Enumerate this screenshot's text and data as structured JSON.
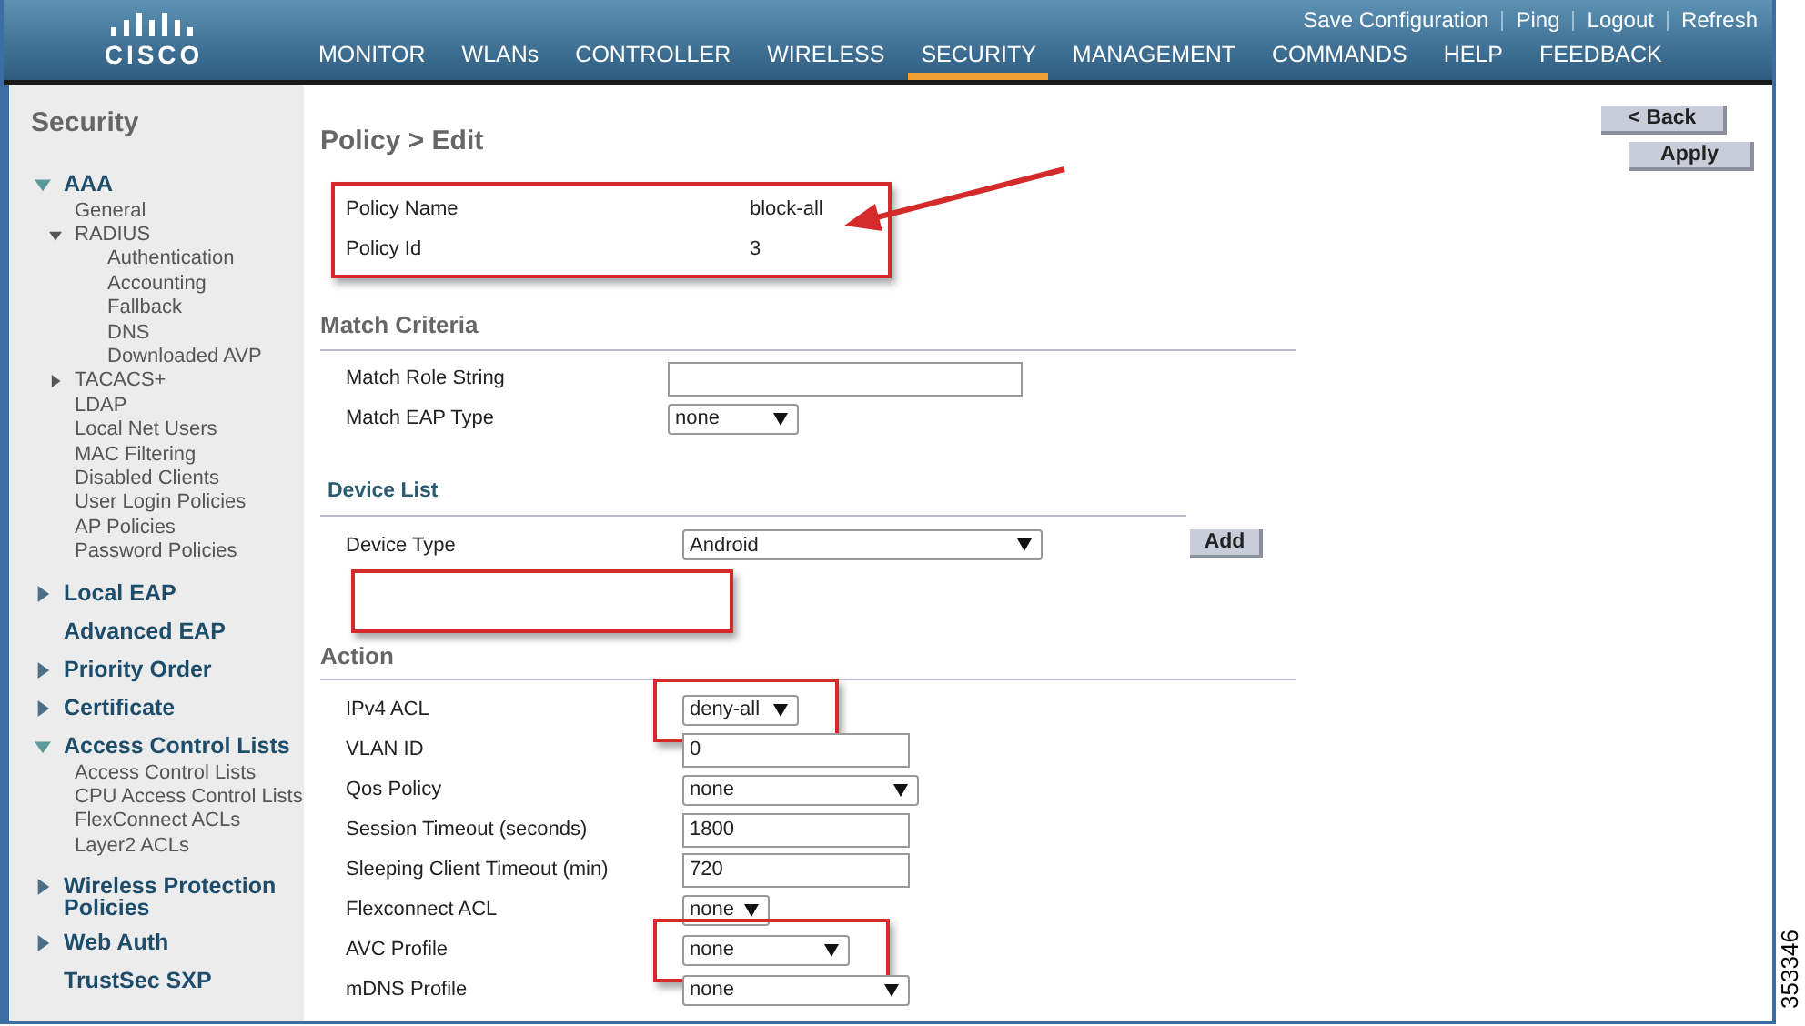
{
  "header": {
    "logo": "CISCO",
    "top_links": [
      "Save Configuration",
      "Ping",
      "Logout",
      "Refresh"
    ],
    "tabs": [
      {
        "label": "MONITOR",
        "selected": false
      },
      {
        "label": "WLANs",
        "selected": false
      },
      {
        "label": "CONTROLLER",
        "selected": false
      },
      {
        "label": "WIRELESS",
        "selected": false
      },
      {
        "label": "SECURITY",
        "selected": true
      },
      {
        "label": "MANAGEMENT",
        "selected": false
      },
      {
        "label": "COMMANDS",
        "selected": false
      },
      {
        "label": "HELP",
        "selected": false
      },
      {
        "label": "FEEDBACK",
        "selected": false
      }
    ]
  },
  "sidebar": {
    "title": "Security",
    "items": [
      {
        "label": "AAA",
        "expanded": true,
        "children": [
          {
            "label": "General"
          },
          {
            "label": "RADIUS",
            "expanded": true,
            "children": [
              {
                "label": "Authentication"
              },
              {
                "label": "Accounting"
              },
              {
                "label": "Fallback"
              },
              {
                "label": "DNS"
              },
              {
                "label": "Downloaded AVP"
              }
            ]
          },
          {
            "label": "TACACS+",
            "expanded": false
          },
          {
            "label": "LDAP"
          },
          {
            "label": "Local Net Users"
          },
          {
            "label": "MAC Filtering"
          },
          {
            "label": "Disabled Clients"
          },
          {
            "label": "User Login Policies"
          },
          {
            "label": "AP Policies"
          },
          {
            "label": "Password Policies"
          }
        ]
      },
      {
        "label": "Local EAP",
        "expanded": false
      },
      {
        "label": "Advanced EAP"
      },
      {
        "label": "Priority Order",
        "expanded": false
      },
      {
        "label": "Certificate",
        "expanded": false
      },
      {
        "label": "Access Control Lists",
        "expanded": true,
        "children": [
          {
            "label": "Access Control Lists"
          },
          {
            "label": "CPU Access Control Lists"
          },
          {
            "label": "FlexConnect ACLs"
          },
          {
            "label": "Layer2 ACLs"
          }
        ]
      },
      {
        "label": "Wireless Protection Policies",
        "expanded": false
      },
      {
        "label": "Web Auth",
        "expanded": false
      },
      {
        "label": "TrustSec SXP"
      }
    ]
  },
  "page": {
    "title": "Policy > Edit",
    "buttons": [
      "< Back",
      "Apply"
    ],
    "policy_info": {
      "highlighted": true,
      "arrow": true,
      "rows": [
        {
          "label": "Policy Name",
          "value": "block-all"
        },
        {
          "label": "Policy Id",
          "value": "3"
        }
      ]
    },
    "match_criteria": {
      "heading": "Match Criteria",
      "rows": [
        {
          "label": "Match Role String",
          "kind": "text"
        },
        {
          "label": "Match EAP Type",
          "kind": "select",
          "value": "none"
        }
      ]
    },
    "device_list": {
      "heading": "Device List",
      "list_highlighted": true,
      "add_button": "Add",
      "rows": [
        {
          "label": "Device Type",
          "kind": "select",
          "value": "Android"
        }
      ]
    },
    "action": {
      "heading": "Action",
      "rows": [
        {
          "label": "IPv4 ACL",
          "kind": "select",
          "value": "deny-all",
          "highlighted": true
        },
        {
          "label": "VLAN ID",
          "kind": "text",
          "value": "0",
          "highlighted": false
        },
        {
          "label": "Qos Policy",
          "kind": "select",
          "value": "none",
          "highlighted": false
        },
        {
          "label": "Session Timeout (seconds)",
          "kind": "text",
          "value": "1800",
          "highlighted": false
        },
        {
          "label": "Sleeping Client Timeout (min)",
          "kind": "text",
          "value": "720",
          "highlighted": false
        },
        {
          "label": "Flexconnect ACL",
          "kind": "select",
          "value": "none",
          "highlighted": false
        },
        {
          "label": "AVC Profile",
          "kind": "select",
          "value": "none",
          "highlighted": true
        },
        {
          "label": "mDNS Profile",
          "kind": "select",
          "value": "none",
          "highlighted": false
        }
      ]
    }
  },
  "figure_number": "353346"
}
